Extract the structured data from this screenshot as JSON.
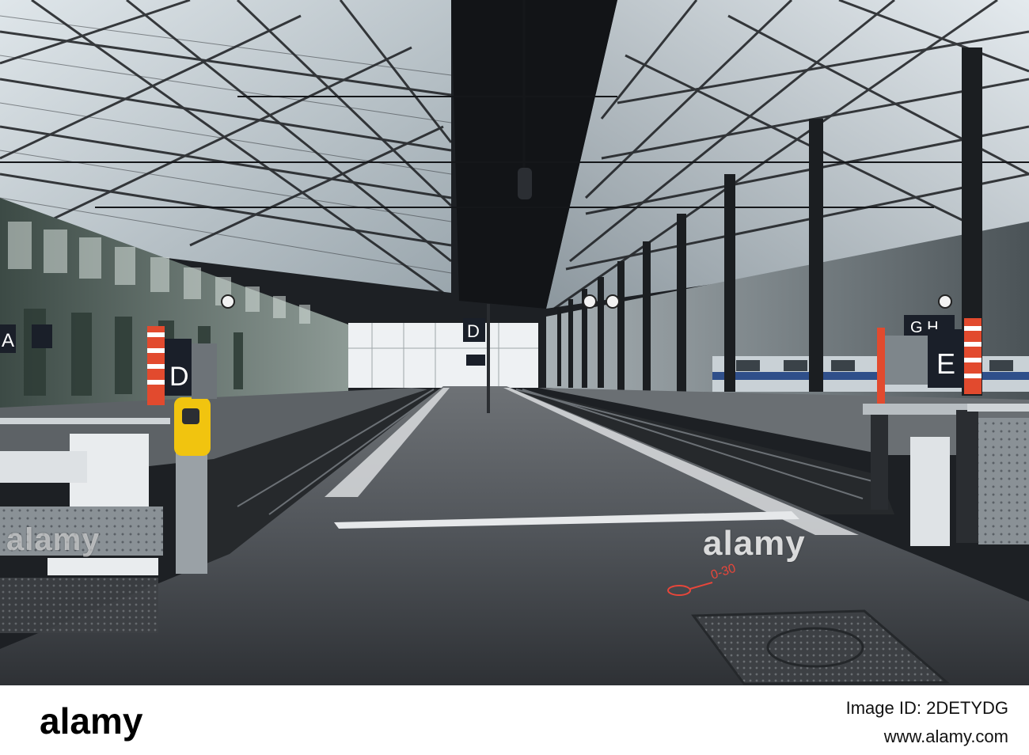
{
  "photo": {
    "subject": "Empty train station platform under an iron and glass roof",
    "signs": {
      "left_edge": "A",
      "platform_left": "D",
      "platform_center": "D",
      "right_header": "G H",
      "platform_right": "E"
    },
    "watermark": "alamy",
    "ground_marking": "0-30"
  },
  "footer": {
    "logo": "alamy",
    "image_id": "Image ID: 2DETYDG",
    "url": "www.alamy.com"
  }
}
